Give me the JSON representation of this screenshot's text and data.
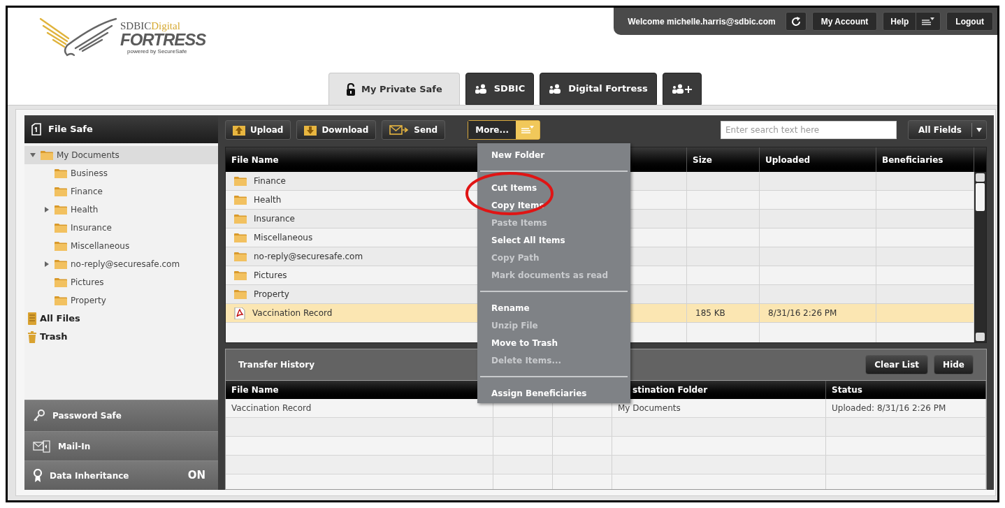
{
  "logo": {
    "brand": "SDBIC",
    "brand_accent": "Digital",
    "product": "FORTRESS",
    "tagline": "powered by SecureSafe"
  },
  "top_bar": {
    "welcome": "Welcome michelle.harris@sdbic.com",
    "buttons": [
      {
        "kind": "refresh"
      },
      {
        "kind": "plain",
        "label": "My Account"
      },
      {
        "kind": "menu",
        "label": "Help"
      },
      {
        "kind": "plain",
        "label": "Logout"
      }
    ]
  },
  "tabs": [
    {
      "kind": "safe",
      "label": "My Private Safe",
      "selected": true
    },
    {
      "kind": "group",
      "label": "SDBIC",
      "selected": false
    },
    {
      "kind": "group",
      "label": "Digital Fortress",
      "selected": false
    },
    {
      "kind": "add",
      "selected": false
    }
  ],
  "sidebar": {
    "title": "File Safe",
    "tree": [
      {
        "kind": "folder",
        "label": "My Documents",
        "selected": true,
        "expandable": true,
        "expanded": true,
        "children": [
          {
            "kind": "folder",
            "label": "Business",
            "selected": false,
            "expandable": false
          },
          {
            "kind": "folder",
            "label": "Finance",
            "selected": false,
            "expandable": false
          },
          {
            "kind": "folder",
            "label": "Health",
            "selected": false,
            "expandable": true,
            "expanded": false
          },
          {
            "kind": "folder",
            "label": "Insurance",
            "selected": false,
            "expandable": false
          },
          {
            "kind": "folder",
            "label": "Miscellaneous",
            "selected": false,
            "expandable": false
          },
          {
            "kind": "folder",
            "label": "no-reply@securesafe.com",
            "selected": false,
            "expandable": true,
            "expanded": false
          },
          {
            "kind": "folder",
            "label": "Pictures",
            "selected": false,
            "expandable": false
          },
          {
            "kind": "folder",
            "label": "Property",
            "selected": false,
            "expandable": false
          }
        ]
      },
      {
        "kind": "all-files",
        "label": "All Files",
        "selected": false,
        "expandable": false
      },
      {
        "kind": "trash",
        "label": "Trash",
        "selected": false,
        "expandable": false
      }
    ],
    "sections": [
      {
        "kind": "password",
        "label": "Password Safe"
      },
      {
        "kind": "mail",
        "label": "Mail-In"
      },
      {
        "kind": "inheritance",
        "label": "Data Inheritance",
        "status": "ON"
      }
    ]
  },
  "toolbar": {
    "buttons": [
      {
        "kind": "upload",
        "label": "Upload"
      },
      {
        "kind": "download",
        "label": "Download"
      },
      {
        "kind": "send",
        "label": "Send"
      }
    ],
    "more": {
      "label": "More...",
      "open": true
    },
    "search": {
      "placeholder": "Enter search text here"
    },
    "filter": {
      "value": "All Fields"
    }
  },
  "file_table": {
    "columns": [
      "File Name",
      null,
      "Size",
      "Uploaded",
      "Beneficiaries"
    ],
    "rows": [
      {
        "kind": "folder",
        "name": "Finance",
        "selected": false
      },
      {
        "kind": "folder",
        "name": "Health",
        "selected": false
      },
      {
        "kind": "folder",
        "name": "Insurance",
        "selected": false
      },
      {
        "kind": "folder",
        "name": "Miscellaneous",
        "selected": false
      },
      {
        "kind": "folder",
        "name": "no-reply@securesafe.com",
        "selected": false
      },
      {
        "kind": "folder",
        "name": "Pictures",
        "selected": false
      },
      {
        "kind": "folder",
        "name": "Property",
        "selected": false
      },
      {
        "kind": "pdf",
        "name": "Vaccination Record",
        "size": "185 KB",
        "uploaded": "8/31/16 2:26 PM",
        "selected": true
      }
    ]
  },
  "menu": {
    "items": [
      {
        "kind": "item",
        "label": "New Folder",
        "disabled": false
      },
      {
        "kind": "separator"
      },
      {
        "kind": "item",
        "label": "Cut Items",
        "disabled": false
      },
      {
        "kind": "item",
        "label": "Copy Items",
        "disabled": false
      },
      {
        "kind": "item",
        "label": "Paste Items",
        "disabled": true
      },
      {
        "kind": "item",
        "label": "Select All Items",
        "disabled": false
      },
      {
        "kind": "item",
        "label": "Copy Path",
        "disabled": true
      },
      {
        "kind": "item",
        "label": "Mark documents as read",
        "disabled": true
      },
      {
        "kind": "separator"
      },
      {
        "kind": "item",
        "label": "Rename",
        "disabled": false
      },
      {
        "kind": "item",
        "label": "Unzip File",
        "disabled": true
      },
      {
        "kind": "item",
        "label": "Move to Trash",
        "disabled": false
      },
      {
        "kind": "item",
        "label": "Delete Items...",
        "disabled": true
      },
      {
        "kind": "separator"
      },
      {
        "kind": "item",
        "label": "Assign Beneficiaries",
        "disabled": false
      }
    ]
  },
  "annotation": {
    "kind": "circle"
  },
  "transfer_history": {
    "title": "Transfer History",
    "buttons": [
      "Clear List",
      "Hide"
    ],
    "columns": [
      "File Name",
      null,
      null,
      "stination Folder",
      "Status"
    ],
    "rows": [
      {
        "cells": [
          "Vaccination Record",
          null,
          null,
          "My Documents",
          "Uploaded: 8/31/16 2:26 PM"
        ]
      }
    ]
  }
}
